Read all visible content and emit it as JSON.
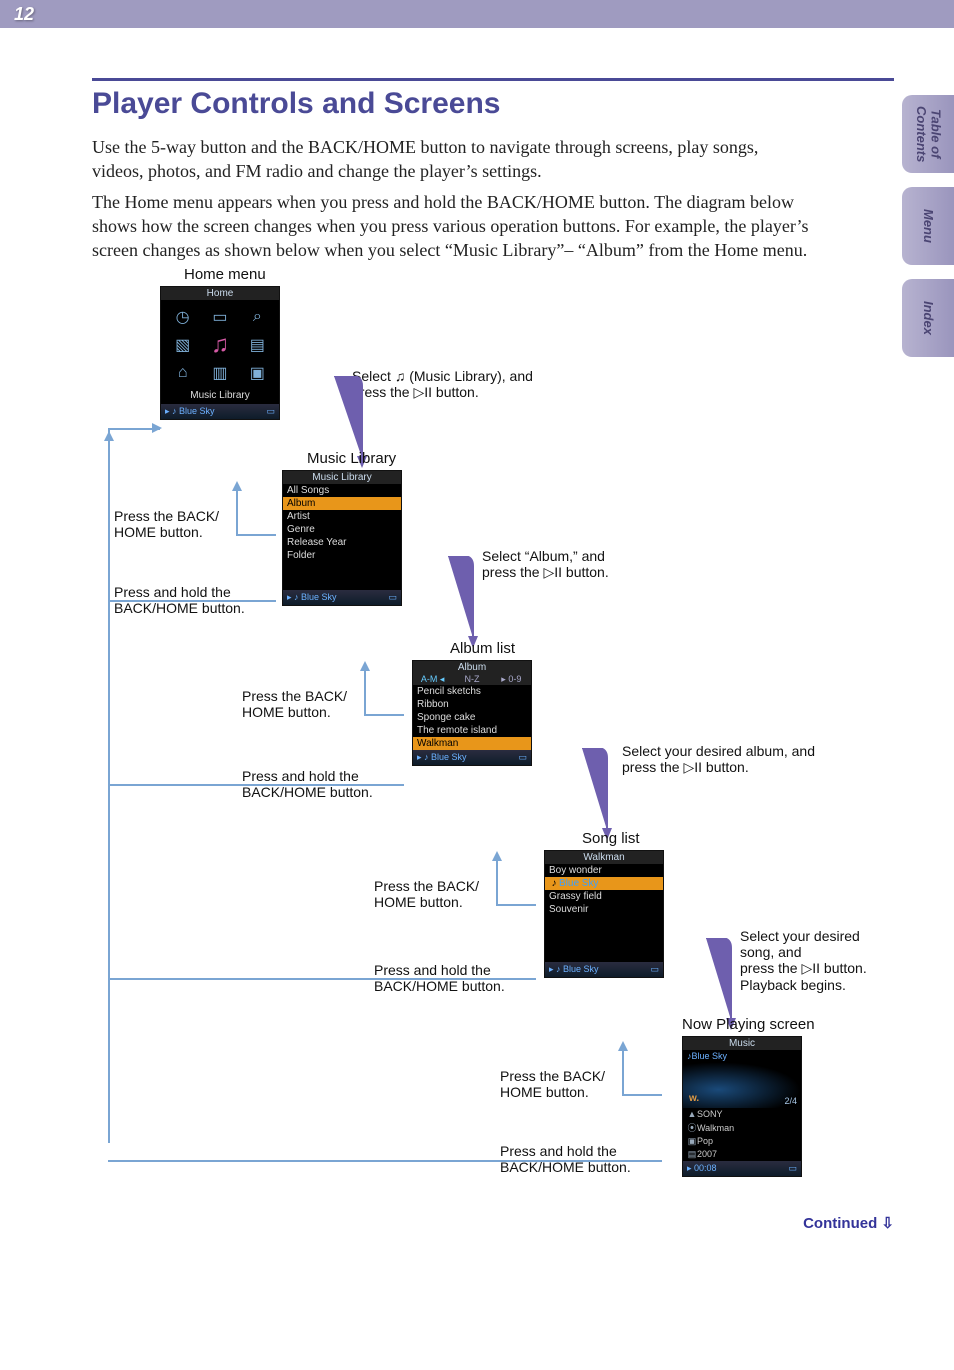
{
  "page_number": "12",
  "side_tabs": {
    "toc": "Table of\nContents",
    "menu": "Menu",
    "index": "Index"
  },
  "heading": "Player Controls and Screens",
  "intro_p1": "Use the 5-way button and the BACK/HOME button to navigate through screens, play songs, videos, photos, and FM radio and change the player’s settings.",
  "intro_p2": "The Home menu appears when you press and hold the BACK/HOME button. The diagram below shows how the screen changes when you press various operation buttons. For example, the player’s screen changes as shown below when you select “Music Library”– “Album” from the Home menu.",
  "labels": {
    "home_menu": "Home menu",
    "music_library": "Music Library",
    "album_list": "Album list",
    "song_list": "Song list",
    "now_playing": "Now Playing screen",
    "press_back": "Press the BACK/\nHOME button.",
    "press_hold": "Press and hold the\nBACK/HOME button.",
    "step1": "Select     (Music Library), and press the       button.",
    "step2_a": "Select “Album,” and",
    "step2_b": "press the       button.",
    "step3_a": "Select your desired album, and",
    "step3_b": "press the       button.",
    "step4_a": "Select your desired song, and",
    "step4_b": "press the       button.",
    "step4_c": "Playback begins."
  },
  "screens": {
    "home": {
      "title": "Home",
      "caption": "Music Library",
      "footer_left": "▸ ♪ Blue Sky"
    },
    "music_library": {
      "title": "Music Library",
      "items": [
        "All Songs",
        "Album",
        "Artist",
        "Genre",
        "Release Year",
        "Folder"
      ],
      "selected": 1,
      "footer_left": "▸ ♪ Blue Sky"
    },
    "album_list": {
      "title": "Album",
      "cats": [
        "A-M ◂",
        "N-Z",
        "▸ 0-9"
      ],
      "items": [
        "Pencil sketchs",
        "Ribbon",
        "Sponge cake",
        "The remote island",
        "Walkman"
      ],
      "selected": 4,
      "footer_left": "▸ ♪ Blue Sky"
    },
    "song_list": {
      "title": "Walkman",
      "items": [
        "Boy wonder",
        "Blue Sky",
        "Grassy field",
        "Souvenir"
      ],
      "selected": 1,
      "footer_left": "▸ ♪ Blue Sky"
    },
    "now_playing": {
      "title": "Music",
      "song": "♪Blue Sky",
      "track": "2/4",
      "artist": "SONY",
      "album": "Walkman",
      "genre": "Pop",
      "year": "2007",
      "time": "00:08"
    }
  },
  "continued": "Continued"
}
